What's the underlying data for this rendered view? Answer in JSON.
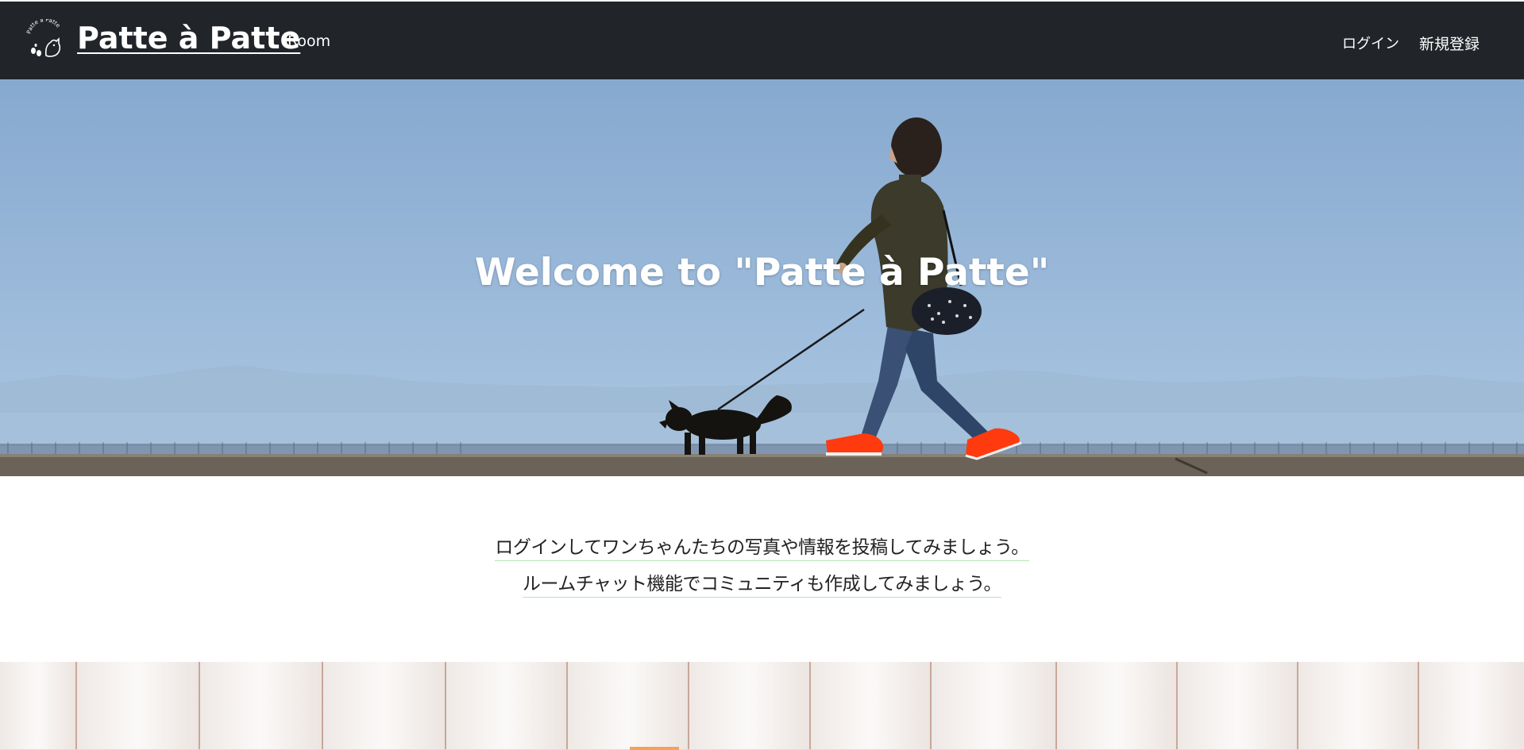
{
  "navbar": {
    "logo_text": "Patte à Patte",
    "brand": "Patte à Patte",
    "room_label": "Room",
    "login_label": "ログイン",
    "signup_label": "新規登録"
  },
  "hero": {
    "title": "Welcome to \"Patte à Patte\""
  },
  "intro": {
    "line1": "ログインしてワンちゃんたちの写真や情報を投稿してみましょう。",
    "line2": "ルームチャット機能でコミュニティも作成してみましょう。"
  },
  "colors": {
    "navbar_bg": "#212529",
    "sky_top": "#86a9cf",
    "sky_bottom": "#a9c5e0",
    "accent_shoe": "#ff3a0e"
  }
}
